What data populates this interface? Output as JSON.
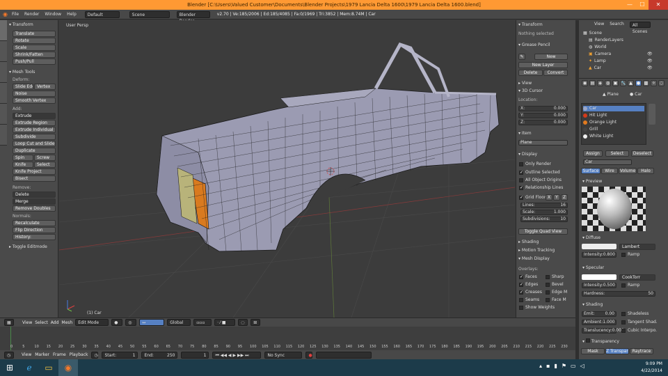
{
  "window": {
    "title": "Blender [C:\\Users\\Valued Customer\\Documents\\Blender Projects\\1979 Lancia Delta 1600\\1979 Lancia Delta 1600.blend]",
    "min": "—",
    "max": "☐",
    "close": "✕"
  },
  "menubar": {
    "file": "File",
    "render_menu": "Render",
    "window": "Window",
    "help": "Help",
    "screen_layout": "Default",
    "scene": "Scene",
    "engine": "Blender Render",
    "stats": "v2.70 | Ve:185/2006 | Ed:185/4085 | Fa:0/1969 | Tri:3852 | Mem:8.74M | Car"
  },
  "toolshelf": {
    "transform_header": "Transform",
    "translate": "Translate",
    "rotate": "Rotate",
    "scale": "Scale",
    "shrink": "Shrink/Fatten",
    "push": "Push/Pull",
    "mesh_tools_header": "Mesh Tools",
    "deform": "Deform:",
    "slide_edge": "Slide Edge",
    "slide_vertex": "Vertex",
    "noise": "Noise",
    "smooth": "Smooth Vertex",
    "add": "Add:",
    "extrude": "Extrude",
    "extrude_region": "Extrude Region",
    "extrude_individual": "Extrude Individual",
    "subdivide": "Subdivide",
    "loop_cut": "Loop Cut and Slide",
    "duplicate": "Duplicate",
    "spin": "Spin",
    "screw": "Screw",
    "knife": "Knife",
    "select": "Select",
    "knife_project": "Knife Project",
    "bisect": "Bisect",
    "remove": "Remove:",
    "delete": "Delete",
    "merge": "Merge",
    "remove_doubles": "Remove Doubles",
    "normals": "Normals:",
    "recalculate": "Recalculate",
    "flip": "Flip Direction",
    "history": "History:",
    "toggle_editmode": "Toggle Editmode"
  },
  "viewport": {
    "label": "User Persp",
    "object": "(1) Car"
  },
  "npanel": {
    "transform": "Transform",
    "nothing": "Nothing selected",
    "grease_pencil": "Grease Pencil",
    "new": "New",
    "new_layer": "New Layer",
    "delete_frame": "Delete Frame",
    "convert": "Convert",
    "view": "View",
    "cursor": "3D Cursor",
    "location": "Location:",
    "cx": "X:",
    "cy": "Y:",
    "cz": "Z:",
    "cxv": "0.000",
    "cyv": "0.000",
    "czv": "0.000",
    "item": "Item",
    "item_name": "Plane",
    "display": "Display",
    "only_render": "Only Render",
    "outline_sel": "Outline Selected",
    "all_origins": "All Object Origins",
    "relationship": "Relationship Lines",
    "grid_floor": "Grid Floor",
    "gx": "X",
    "gy": "Y",
    "gz": "Z",
    "lines": "Lines:",
    "lines_v": "16",
    "scale": "Scale:",
    "scale_v": "1.000",
    "subdiv": "Subdivisions:",
    "subdiv_v": "10",
    "toggle_quad": "Toggle Quad View",
    "shading": "Shading",
    "motion_tracking": "Motion Tracking",
    "mesh_display": "Mesh Display",
    "overlays": "Overlays:",
    "faces": "Faces",
    "sharp": "Sharp",
    "edges": "Edges",
    "bevel": "Bevel",
    "creases": "Creases",
    "edge_marks": "Edge M",
    "seams": "Seams",
    "face_marks": "Face M",
    "show_weights": "Show Weights"
  },
  "outliner": {
    "view": "View",
    "search": "Search",
    "all_scenes": "All Scenes",
    "scene": "Scene",
    "layers": "RenderLayers",
    "world": "World",
    "camera": "Camera",
    "lamp": "Lamp",
    "car": "Car"
  },
  "props": {
    "plane": "Plane",
    "car": "Car",
    "materials": [
      {
        "name": "Car",
        "color": "#9aa7c8"
      },
      {
        "name": "Hit Light",
        "color": "#d43a1a"
      },
      {
        "name": "Orange Light",
        "color": "#e07a1f"
      },
      {
        "name": "Grill",
        "color": "#444444"
      },
      {
        "name": "White Light",
        "color": "#eeeeee"
      }
    ],
    "assign": "Assign",
    "select": "Select",
    "deselect": "Deselect",
    "matname": "Car",
    "surface": "Surface",
    "wire": "Wire",
    "volume": "Volume",
    "halo": "Halo",
    "preview": "Preview",
    "diffuse": "Diffuse",
    "lambert": "Lambert",
    "intensity": "Intensity:",
    "intensity_v": "0.800",
    "ramp": "Ramp",
    "specular": "Specular",
    "cooktorr": "CookTorr",
    "spec_int": "Intensity:",
    "spec_int_v": "0.500",
    "hardness": "Hardness:",
    "hardness_v": "50",
    "shading": "Shading",
    "emit": "Emit:",
    "emit_v": "0.00",
    "shadeless": "Shadeless",
    "ambient": "Ambient:",
    "ambient_v": "1.000",
    "tangent": "Tangent Shad.",
    "translucency": "Translucency:",
    "translucency_v": "0.000",
    "cubic": "Cubic Interpo.",
    "transparency": "Transparency",
    "mask": "Mask",
    "z_transparency": "Z Transparency",
    "raytrace": "Raytrace"
  },
  "header3d": {
    "view": "View",
    "select": "Select",
    "add": "Add",
    "mesh": "Mesh",
    "mode": "Edit Mode",
    "pivot": "Global"
  },
  "timeline": {
    "view": "View",
    "marker": "Marker",
    "frame": "Frame",
    "playback": "Playback",
    "start": "Start:",
    "start_v": "1",
    "end": "End:",
    "end_v": "250",
    "current": "1",
    "sync": "No Sync",
    "ticks": [
      "0",
      "5",
      "10",
      "15",
      "20",
      "25",
      "30",
      "35",
      "40",
      "45",
      "50",
      "55",
      "60",
      "65",
      "70",
      "75",
      "80",
      "85",
      "90",
      "95",
      "100",
      "105",
      "110",
      "115",
      "120",
      "125",
      "130",
      "135",
      "140",
      "145",
      "150",
      "155",
      "160",
      "165",
      "170",
      "175",
      "180",
      "185",
      "190",
      "195",
      "200",
      "205",
      "210",
      "215",
      "220",
      "225",
      "230"
    ]
  },
  "taskbar": {
    "time": "9:09 PM",
    "date": "4/22/2014"
  },
  "colors": {
    "title_bar": "#ff9933",
    "viewport": "#3c3c3c",
    "wire": "#141414",
    "mesh_face": "#9b9bb2",
    "accent": "#5680c2"
  }
}
